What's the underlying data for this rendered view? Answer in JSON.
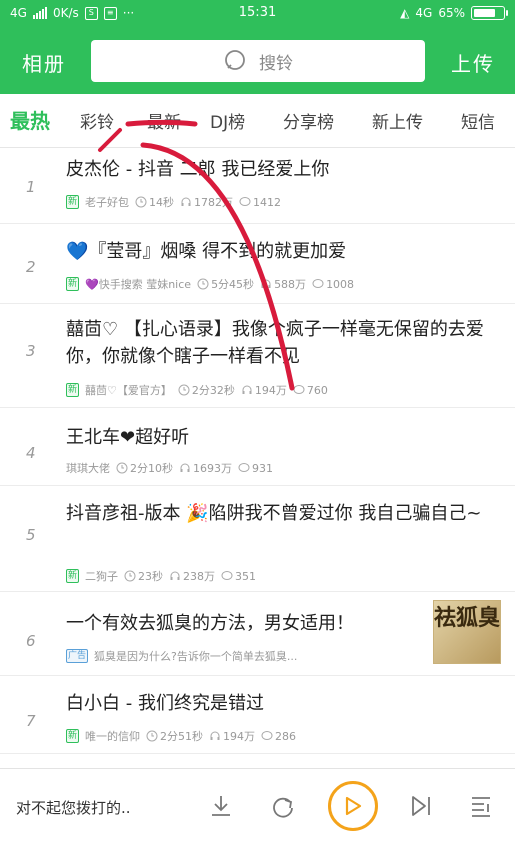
{
  "status_bar": {
    "network": "4G",
    "speed": "0K/s",
    "time": "15:31",
    "network_right": "4G",
    "battery_text": "65%",
    "battery_level": 0.65
  },
  "header": {
    "left_label": "相册",
    "search_placeholder": "搜铃",
    "right_label": "上传"
  },
  "tabs": [
    {
      "label": "最热",
      "active": true
    },
    {
      "label": "彩铃"
    },
    {
      "label": "最新"
    },
    {
      "label": "DJ榜"
    },
    {
      "label": "分享榜"
    },
    {
      "label": "新上传"
    },
    {
      "label": "短信"
    }
  ],
  "list": [
    {
      "rank": "1",
      "title": "皮杰伦 - 抖音 二郎 我已经爱上你",
      "badge": "新",
      "author": "老子好包",
      "duration": "14秒",
      "plays": "1782万",
      "comments": "1412"
    },
    {
      "rank": "2",
      "title": "💙『莹哥』烟嗓 得不到的就更加爱",
      "badge": "新",
      "author": "💜快手搜索 莹妹nice",
      "duration": "5分45秒",
      "plays": "588万",
      "comments": "1008"
    },
    {
      "rank": "3",
      "title": "囍茴♡ 【扎心语录】我像个疯子一样毫无保留的去爱你，你就像个瞎子一样看不见",
      "badge": "新",
      "author": "囍茴♡【爱官方】",
      "duration": "2分32秒",
      "plays": "194万",
      "comments": "760"
    },
    {
      "rank": "4",
      "title": "王北车❤超好听",
      "badge": "",
      "author": "琪琪大佬",
      "duration": "2分10秒",
      "plays": "1693万",
      "comments": "931"
    },
    {
      "rank": "5",
      "title": "抖音彦祖-版本 🎉陷阱我不曾爱过你 我自己骗自己~",
      "badge": "新",
      "author": "二狗子",
      "duration": "23秒",
      "plays": "238万",
      "comments": "351"
    },
    {
      "rank": "6",
      "title": "一个有效去狐臭的方法，男女适用！",
      "badge": "广告",
      "author": "狐臭是因为什么?告诉你一个简单去狐臭...",
      "duration": "",
      "plays": "",
      "comments": "",
      "thumb_text": "祛狐臭"
    },
    {
      "rank": "7",
      "title": "白小白 - 我们终究是错过",
      "badge": "新",
      "author": "唯一的信仰",
      "duration": "2分51秒",
      "plays": "194万",
      "comments": "286"
    }
  ],
  "player": {
    "now_playing": "对不起您拨打的..",
    "accent_color": "#f4a31a"
  },
  "colors": {
    "brand": "#2fbf5b",
    "annotation": "#d81b3c"
  }
}
